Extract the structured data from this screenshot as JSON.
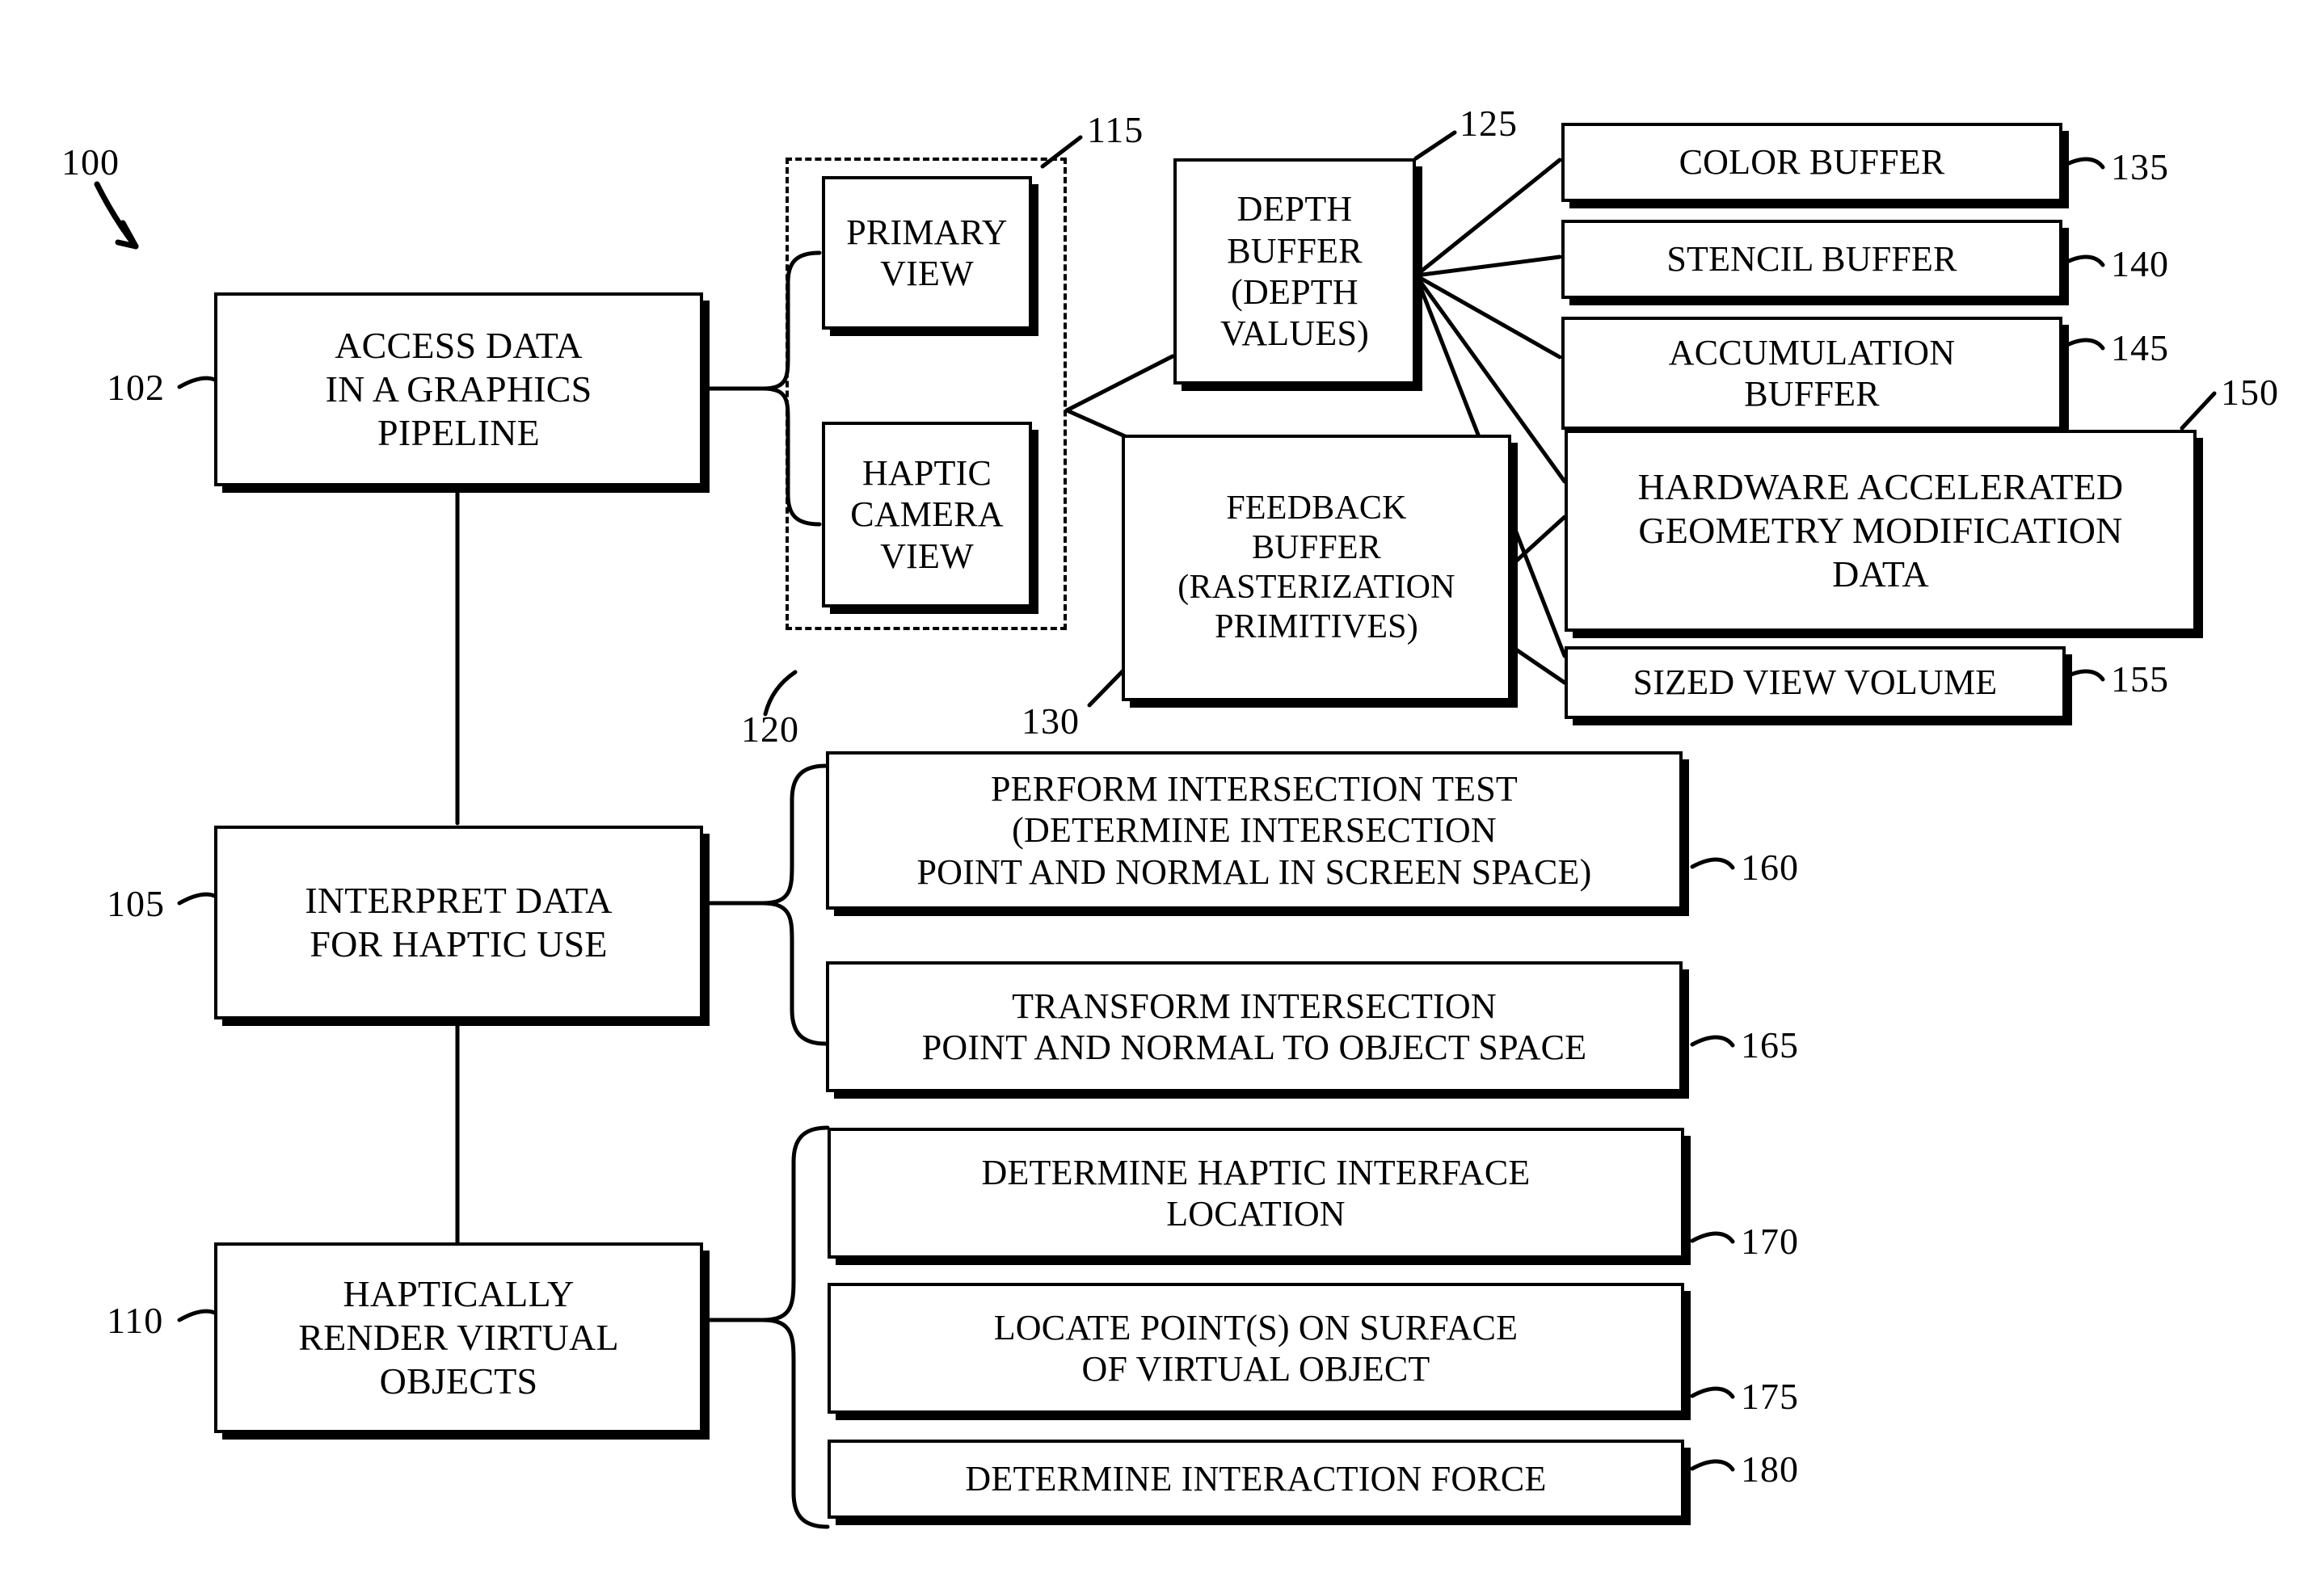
{
  "figure": {
    "number": "100",
    "type": "patent-flow-diagram",
    "description": "Method flow for accessing graphics pipeline data, interpreting it for haptic use, and haptically rendering virtual objects"
  },
  "boxes": [
    {
      "id": "102",
      "ref": "102",
      "label": "ACCESS DATA\nIN A GRAPHICS\nPIPELINE"
    },
    {
      "id": "115",
      "ref": "115",
      "label": "PRIMARY\nVIEW"
    },
    {
      "id": "120",
      "ref": "120",
      "label": "HAPTIC\nCAMERA\nVIEW"
    },
    {
      "id": "125",
      "ref": "125",
      "label": "DEPTH\nBUFFER\n(DEPTH\nVALUES)"
    },
    {
      "id": "130",
      "ref": "130",
      "label": "FEEDBACK\nBUFFER\n(RASTERIZATION\nPRIMITIVES)"
    },
    {
      "id": "135",
      "ref": "135",
      "label": "COLOR BUFFER"
    },
    {
      "id": "140",
      "ref": "140",
      "label": "STENCIL BUFFER"
    },
    {
      "id": "145",
      "ref": "145",
      "label": "ACCUMULATION\nBUFFER"
    },
    {
      "id": "150",
      "ref": "150",
      "label": "HARDWARE ACCELERATED\nGEOMETRY MODIFICATION\nDATA"
    },
    {
      "id": "155",
      "ref": "155",
      "label": "SIZED VIEW VOLUME"
    },
    {
      "id": "105",
      "ref": "105",
      "label": "INTERPRET DATA\nFOR HAPTIC USE"
    },
    {
      "id": "160",
      "ref": "160",
      "label": "PERFORM INTERSECTION TEST\n(DETERMINE INTERSECTION\nPOINT AND NORMAL IN SCREEN SPACE)"
    },
    {
      "id": "165",
      "ref": "165",
      "label": "TRANSFORM INTERSECTION\nPOINT AND NORMAL TO OBJECT SPACE"
    },
    {
      "id": "110",
      "ref": "110",
      "label": "HAPTICALLY\nRENDER VIRTUAL\nOBJECTS"
    },
    {
      "id": "170",
      "ref": "170",
      "label": "DETERMINE HAPTIC INTERFACE\nLOCATION"
    },
    {
      "id": "175",
      "ref": "175",
      "label": "LOCATE POINT(S) ON SURFACE\nOF VIRTUAL OBJECT"
    },
    {
      "id": "180",
      "ref": "180",
      "label": "DETERMINE INTERACTION FORCE"
    }
  ],
  "colors": {
    "ink": "#000000",
    "paper": "#ffffff"
  }
}
